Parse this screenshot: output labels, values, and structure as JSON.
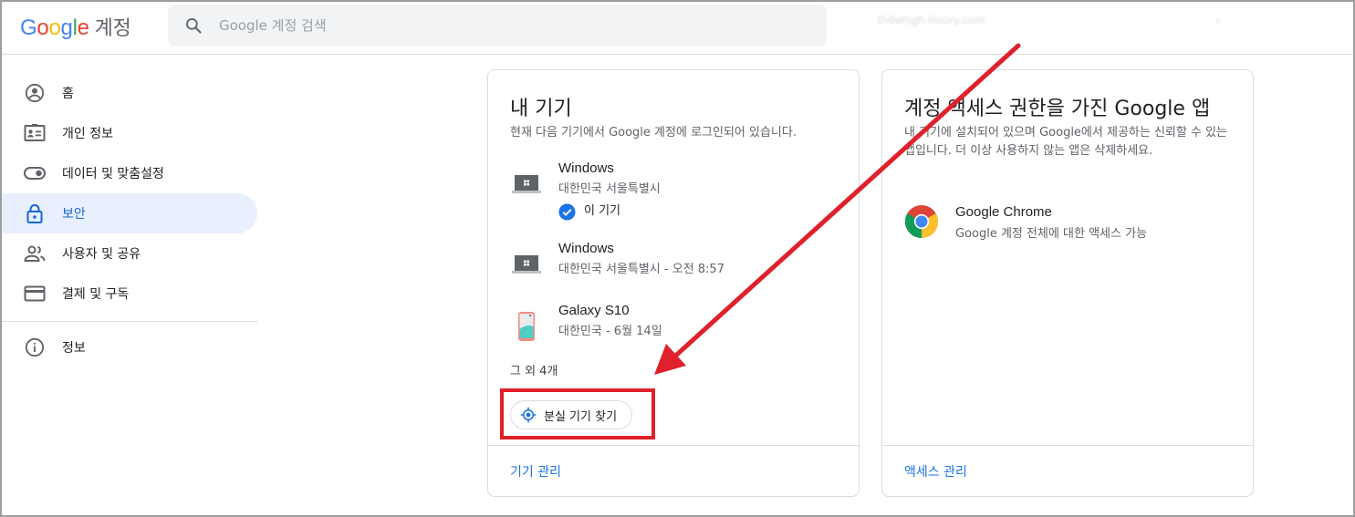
{
  "header": {
    "logo_letters": [
      "G",
      "o",
      "o",
      "g",
      "l",
      "e"
    ],
    "product_name": "계정",
    "search_placeholder": "Google 계정 검색",
    "blurred_url": "thdwlsgh.tistory.com"
  },
  "sidebar": {
    "items": [
      {
        "label": "홈",
        "icon": "account-circle-icon",
        "active": false
      },
      {
        "label": "개인 정보",
        "icon": "id-card-icon",
        "active": false
      },
      {
        "label": "데이터 및 맞춤설정",
        "icon": "toggle-icon",
        "active": false
      },
      {
        "label": "보안",
        "icon": "lock-icon",
        "active": true
      },
      {
        "label": "사용자 및 공유",
        "icon": "people-icon",
        "active": false
      },
      {
        "label": "결제 및 구독",
        "icon": "credit-card-icon",
        "active": false
      }
    ],
    "info_item": {
      "label": "정보",
      "icon": "info-icon"
    }
  },
  "devices_card": {
    "title": "내 기기",
    "description": "현재 다음 기기에서 Google 계정에 로그인되어 있습니다.",
    "devices": [
      {
        "name": "Windows",
        "location": "대한민국 서울특별시",
        "this_device_label": "이 기기",
        "icon": "laptop-windows-icon"
      },
      {
        "name": "Windows",
        "location": "대한민국 서울특별시 - 오전 8:57",
        "icon": "laptop-windows-icon"
      },
      {
        "name": "Galaxy S10",
        "location": "대한민국 - 6월 14일",
        "icon": "smartphone-icon"
      }
    ],
    "more_label": "그 외 4개",
    "find_button_label": "분실 기기 찾기",
    "footer_link": "기기 관리"
  },
  "apps_card": {
    "title": "계정 액세스 권한을 가진 Google 앱",
    "description": "내 기기에 설치되어 있으며 Google에서 제공하는 신뢰할 수 있는 앱입니다. 더 이상 사용하지 않는 앱은 삭제하세요.",
    "app": {
      "name": "Google Chrome",
      "access": "Google 계정 전체에 대한 액세스 가능",
      "icon": "chrome-icon"
    },
    "footer_link": "액세스 관리"
  },
  "colors": {
    "brand_blue": "#1a73e8",
    "active_bg": "#e8f0fe",
    "annotation_red": "#e0202a"
  }
}
